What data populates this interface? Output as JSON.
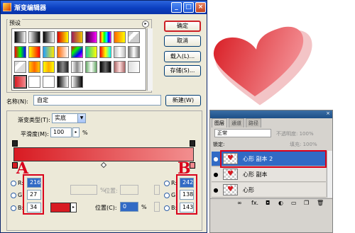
{
  "dialog": {
    "title": "渐变编辑器",
    "buttons": {
      "ok": "确定",
      "cancel": "取消",
      "load": "载入(L)...",
      "save": "存储(S)...",
      "new": "新建(W)"
    },
    "presets_label": "预设",
    "name_label": "名称(N):",
    "name_value": "自定",
    "gradient_type_label": "渐变类型(T):",
    "gradient_type_value": "实底",
    "smoothness_label": "平滑度(M):",
    "smoothness_value": "100",
    "smoothness_unit": "%",
    "left_stop": {
      "marker": "A",
      "r": "216",
      "g": "27",
      "b": "34"
    },
    "right_stop": {
      "marker": "B",
      "r": "242",
      "g": "138",
      "b": "143"
    },
    "channel_labels": {
      "r": "R:",
      "g": "G:",
      "b": "B:"
    },
    "opacity_unit": "%",
    "location_label_top": "位置:",
    "location_label": "位置(C):",
    "location_value": "0",
    "location_unit": "%",
    "colors": {
      "left": "#D81B22",
      "right": "#F28A8F"
    }
  },
  "layers_panel": {
    "tabs": [
      "图层",
      "通道",
      "路径"
    ],
    "blend_mode": "正常",
    "opacity_label": "不透明度: 100%",
    "lock_label": "锁定:",
    "fill_label": "填充: 100%",
    "layers": [
      {
        "name": "心形 副本 2",
        "selected": true,
        "visible": true
      },
      {
        "name": "心形 副本",
        "selected": false,
        "visible": true
      },
      {
        "name": "心形",
        "selected": false,
        "visible": true
      }
    ],
    "footer_icons": [
      "link-icon",
      "fx-icon",
      "mask-icon",
      "adjustment-icon",
      "folder-icon",
      "new-layer-icon",
      "trash-icon"
    ]
  }
}
